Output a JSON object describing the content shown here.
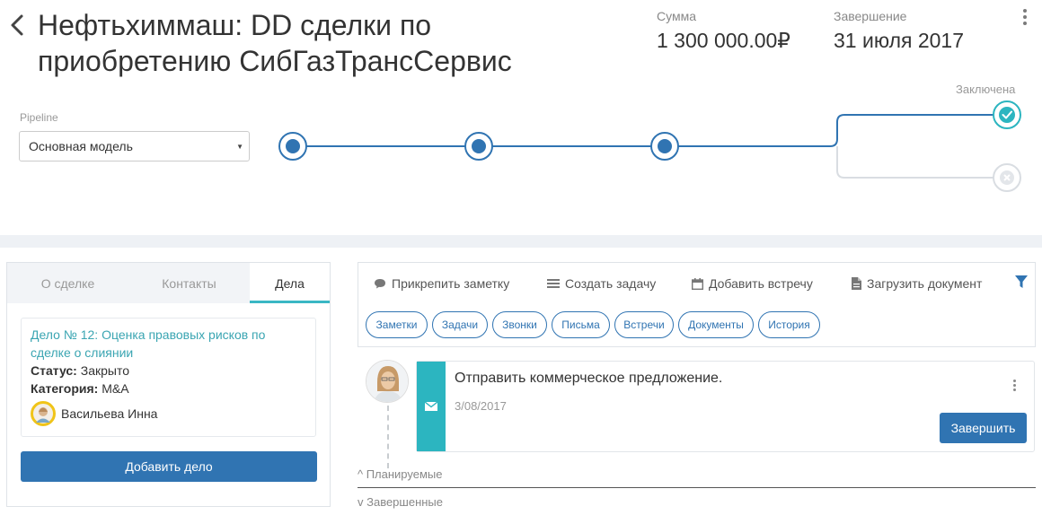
{
  "header": {
    "title": "Нефтьхиммаш: DD сделки по приобретению СибГазТрансСервис",
    "amount_label": "Сумма",
    "amount_value": "1 300 000.00₽",
    "end_label": "Завершение",
    "end_value": "31 июля 2017"
  },
  "pipeline": {
    "label": "Pipeline",
    "selected": "Основная модель",
    "final_stage_label": "Заключена"
  },
  "left_panel": {
    "tabs": [
      "О сделке",
      "Контакты",
      "Дела"
    ],
    "active_tab": "Дела",
    "deal": {
      "title": "Дело № 12: Оценка правовых рисков по сделке о слиянии",
      "status_label": "Статус:",
      "status_value": "Закрыто",
      "category_label": "Категория:",
      "category_value": "M&A",
      "assignee": "Васильева Инна"
    },
    "add_button": "Добавить дело"
  },
  "right_panel": {
    "actions": {
      "note": "Прикрепить заметку",
      "task": "Создать задачу",
      "meeting": "Добавить встречу",
      "document": "Загрузить документ"
    },
    "filters": [
      "Заметки",
      "Задачи",
      "Звонки",
      "Письма",
      "Встречи",
      "Документы",
      "История"
    ]
  },
  "timeline": {
    "task_title": "Отправить коммерческое предложение.",
    "task_date": "3/08/2017",
    "finish_button": "Завершить",
    "planned_label": "^ Планируемые",
    "completed_label": "v Завершенные"
  },
  "colors": {
    "primary": "#3074b2",
    "accent": "#2cb5c0",
    "link": "#3aa5b2",
    "muted": "#999999"
  }
}
